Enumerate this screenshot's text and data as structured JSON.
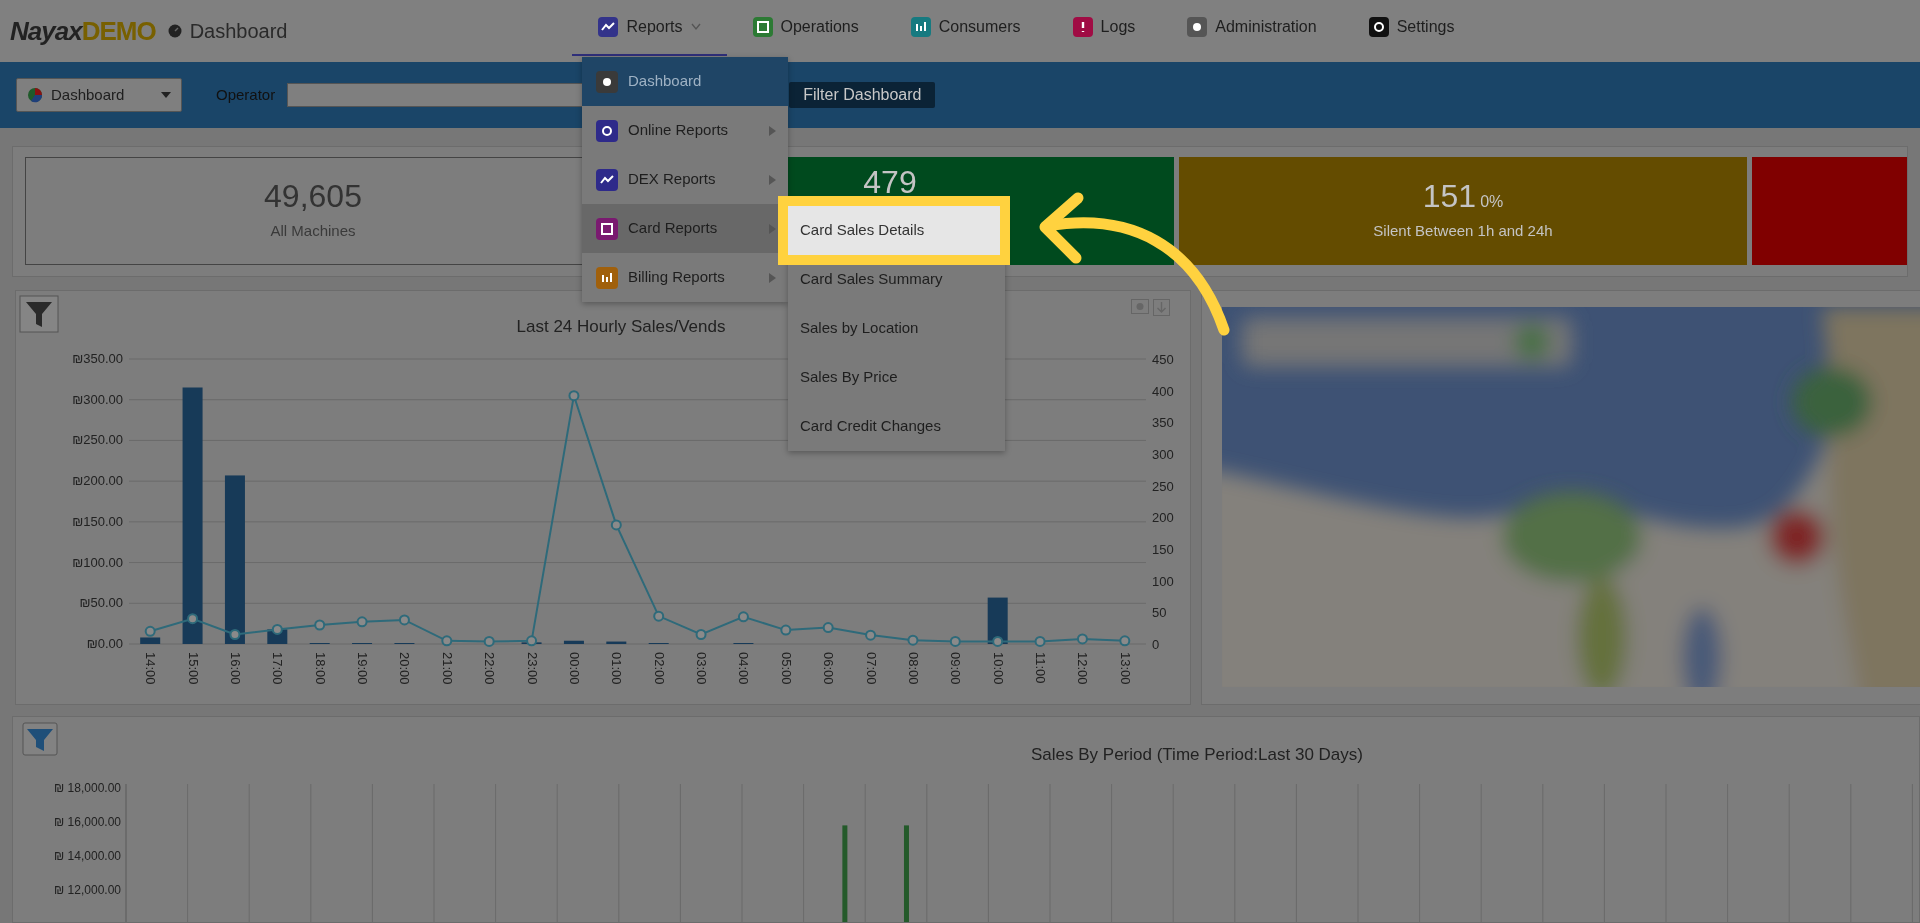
{
  "header": {
    "brand": "Nayax",
    "brand_suffix": "DEMO",
    "page_title": "Dashboard"
  },
  "nav": [
    {
      "label": "Reports",
      "selected": true,
      "color": "#33338a"
    },
    {
      "label": "Operations",
      "selected": false,
      "color": "#2c7a34"
    },
    {
      "label": "Consumers",
      "selected": false,
      "color": "#167a80"
    },
    {
      "label": "Logs",
      "selected": false,
      "color": "#a00c44"
    },
    {
      "label": "Administration",
      "selected": false,
      "color": "#555555"
    },
    {
      "label": "Settings",
      "selected": false,
      "color": "#111111"
    }
  ],
  "filter_bar": {
    "view": "Dashboard",
    "operator_label": "Operator",
    "button": "Filter Dashboard"
  },
  "kpis": [
    {
      "kind": "outline",
      "value": "49,605",
      "label": "All Machines"
    },
    {
      "kind": "filled",
      "color": "#004a1e",
      "value": "479"
    },
    {
      "kind": "filled",
      "color": "#644c00",
      "value": "151",
      "percent": "0%",
      "label": "Silent Between 1h and 24h"
    },
    {
      "kind": "filled",
      "color": "#800000"
    }
  ],
  "hourly_chart": {
    "chart_data": {
      "type": "bar",
      "title": "Last 24 Hourly Sales/Vends",
      "categories": [
        "14:00",
        "15:00",
        "16:00",
        "17:00",
        "18:00",
        "19:00",
        "20:00",
        "21:00",
        "22:00",
        "23:00",
        "00:00",
        "01:00",
        "02:00",
        "03:00",
        "04:00",
        "05:00",
        "06:00",
        "07:00",
        "08:00",
        "09:00",
        "10:00",
        "11:00",
        "12:00",
        "13:00"
      ],
      "ylim": [
        0,
        350
      ],
      "grid": true,
      "yticks": [
        {
          "value": 0,
          "label": "₪0.00"
        },
        {
          "value": 50,
          "label": "₪50.00"
        },
        {
          "value": 100,
          "label": "₪100.00"
        },
        {
          "value": 150,
          "label": "₪150.00"
        },
        {
          "value": 200,
          "label": "₪200.00"
        },
        {
          "value": 250,
          "label": "₪250.00"
        },
        {
          "value": 300,
          "label": "₪300.00"
        },
        {
          "value": 350,
          "label": "₪350.00"
        }
      ],
      "series": [
        {
          "color": "#173a58",
          "values": [
            8,
            315,
            207,
            18,
            1,
            1,
            1,
            0,
            0,
            2,
            4,
            3,
            1,
            0,
            1,
            0,
            0,
            0,
            0,
            0,
            57,
            0,
            0,
            0
          ]
        }
      ]
    },
    "line_overlay": {
      "chart_data": {
        "type": "line",
        "categories": [
          null,
          null,
          null,
          null,
          null,
          null,
          null,
          null,
          null,
          null,
          null,
          null,
          null,
          null,
          null,
          null,
          null,
          null,
          null,
          null,
          null,
          null,
          null,
          null
        ],
        "ylim": [
          0,
          450
        ],
        "yticks": [
          0,
          50,
          100,
          150,
          200,
          250,
          300,
          350,
          400,
          450
        ],
        "series": [
          {
            "color": "#2e6a7a",
            "marker": "circle",
            "values": [
              20,
              40,
              15,
              23,
              30,
              35,
              38,
              5,
              4,
              5,
              392,
              188,
              44,
              15,
              43,
              22,
              26,
              14,
              6,
              4,
              4,
              4,
              8,
              5
            ]
          }
        ]
      }
    }
  },
  "period_chart": {
    "title": "Sales By Period (Time Period:Last 30 Days)",
    "axis_labels": [
      "₪ 18,000.00",
      "₪ 16,000.00",
      "₪ 14,000.00",
      "₪ 12,000.00"
    ]
  },
  "menu": {
    "items": [
      {
        "label": "Dashboard",
        "selected": true,
        "expanded": false,
        "has_submenu": false,
        "color": "#3a3a3a"
      },
      {
        "label": "Online Reports",
        "selected": false,
        "expanded": false,
        "has_submenu": true,
        "color": "#2e2a8a"
      },
      {
        "label": "DEX Reports",
        "selected": false,
        "expanded": false,
        "has_submenu": true,
        "color": "#2e2a8a"
      },
      {
        "label": "Card Reports",
        "selected": false,
        "expanded": true,
        "has_submenu": true,
        "color": "#7a1a70"
      },
      {
        "label": "Billing Reports",
        "selected": false,
        "expanded": false,
        "has_submenu": true,
        "color": "#a0600c"
      }
    ]
  },
  "submenu": {
    "items": [
      {
        "label": "Card Sales Details",
        "highlighted": true
      },
      {
        "label": "Card Sales Summary",
        "highlighted": false
      },
      {
        "label": "Sales by Location",
        "highlighted": false
      },
      {
        "label": "Sales By Price",
        "highlighted": false
      },
      {
        "label": "Card Credit Changes",
        "highlighted": false
      }
    ]
  }
}
